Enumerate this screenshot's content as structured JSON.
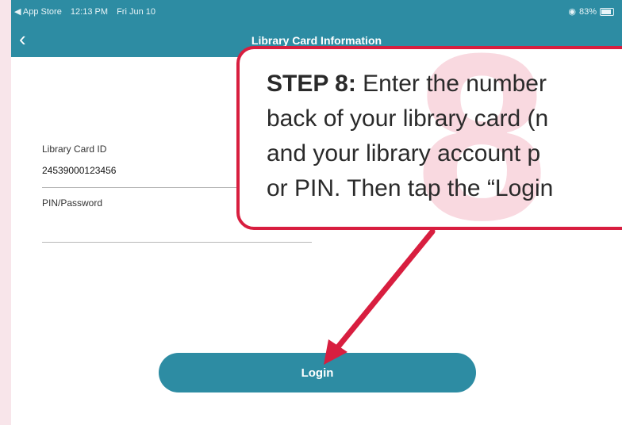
{
  "status_bar": {
    "back_app": "◀ App Store",
    "time": "12:13 PM",
    "date": "Fri Jun 10",
    "battery": "83%"
  },
  "nav": {
    "back_icon": "chevron-left-icon",
    "title": "Library Card Information"
  },
  "form": {
    "card_id_label": "Library Card ID",
    "card_id_value": "24539000123456",
    "pin_label": "PIN/Password",
    "pin_value": ""
  },
  "login_label": "Login",
  "callout": {
    "step_number": "8",
    "step_prefix": "STEP 8:",
    "line1": " Enter the number",
    "line2": "back of your library card (n",
    "line3": "and your library account p",
    "line4": "or PIN. Then tap the “Login"
  },
  "colors": {
    "header": "#2d8ca3",
    "callout_border": "#d81e3f",
    "callout_number": "#f9d9e0",
    "page_edge": "#f8e5ea"
  }
}
